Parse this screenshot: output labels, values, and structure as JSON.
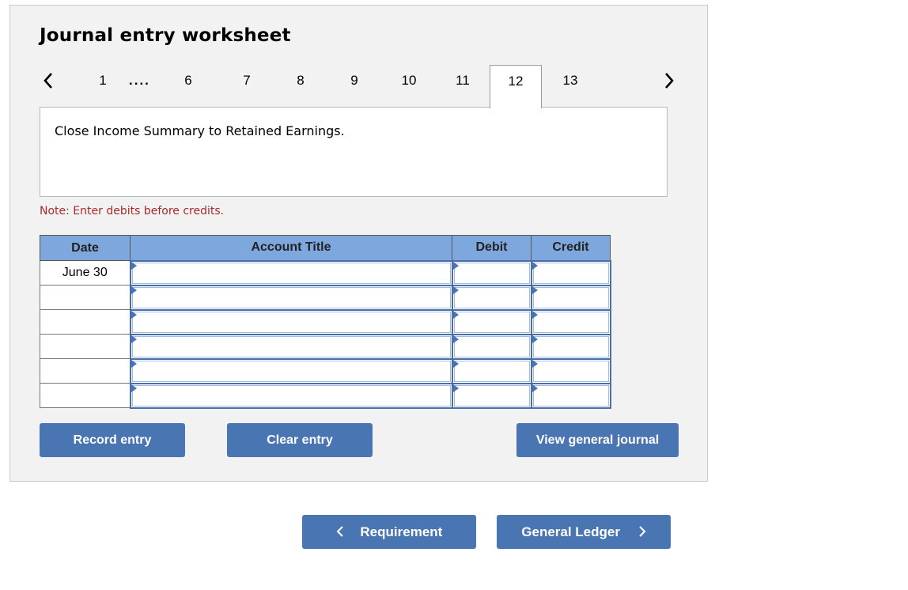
{
  "worksheet": {
    "title": "Journal entry worksheet",
    "nav": {
      "prev_icon": "chevron-left-icon",
      "next_icon": "chevron-right-icon",
      "ellipsis": "....",
      "tabs": [
        {
          "label": "1",
          "active": false
        },
        {
          "label": "6",
          "active": false
        },
        {
          "label": "7",
          "active": false
        },
        {
          "label": "8",
          "active": false
        },
        {
          "label": "9",
          "active": false
        },
        {
          "label": "10",
          "active": false
        },
        {
          "label": "11",
          "active": false
        },
        {
          "label": "12",
          "active": true
        },
        {
          "label": "13",
          "active": false
        }
      ]
    },
    "description": "Close Income Summary to Retained Earnings.",
    "note": "Note: Enter debits before credits.",
    "table": {
      "headers": {
        "date": "Date",
        "account": "Account Title",
        "debit": "Debit",
        "credit": "Credit"
      },
      "rows": [
        {
          "date": "June 30",
          "account": "",
          "debit": "",
          "credit": ""
        },
        {
          "date": "",
          "account": "",
          "debit": "",
          "credit": ""
        },
        {
          "date": "",
          "account": "",
          "debit": "",
          "credit": ""
        },
        {
          "date": "",
          "account": "",
          "debit": "",
          "credit": ""
        },
        {
          "date": "",
          "account": "",
          "debit": "",
          "credit": ""
        },
        {
          "date": "",
          "account": "",
          "debit": "",
          "credit": ""
        }
      ]
    },
    "buttons": {
      "record": "Record entry",
      "clear": "Clear entry",
      "view_journal": "View general journal"
    }
  },
  "footer_nav": {
    "prev_label": "Requirement",
    "prev_icon": "chevron-left-icon",
    "next_label": "General Ledger",
    "next_icon": "chevron-right-icon"
  },
  "colors": {
    "button_bg": "#4a75b3",
    "header_bg": "#7ea7de",
    "note_color": "#a52a2a",
    "panel_bg": "#f2f2f2"
  }
}
